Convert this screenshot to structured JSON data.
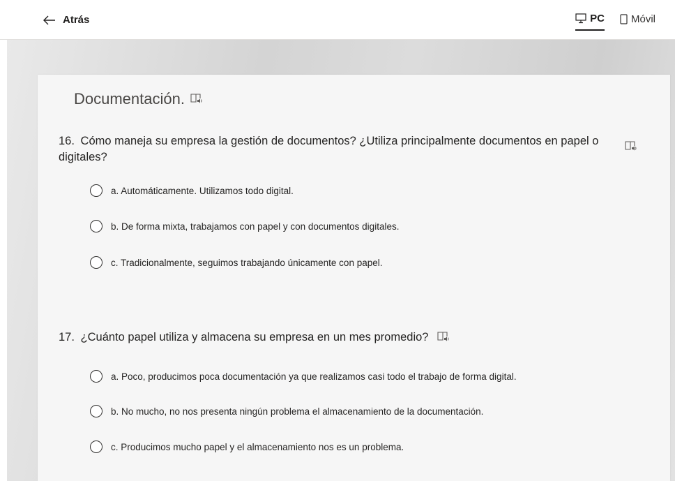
{
  "header": {
    "back_label": "Atrás",
    "views": [
      {
        "label": "PC",
        "active": true
      },
      {
        "label": "Móvil",
        "active": false
      }
    ]
  },
  "section": {
    "title": "Documentación."
  },
  "questions": [
    {
      "number": "16.",
      "text": "Cómo maneja su empresa la gestión de documentos? ¿Utiliza principalmente documentos en papel o digitales?",
      "options": [
        {
          "label": "a. Automáticamente. Utilizamos todo digital."
        },
        {
          "label": "b. De forma mixta, trabajamos con papel y con documentos digitales."
        },
        {
          "label": "c. Tradicionalmente, seguimos trabajando únicamente con papel."
        }
      ]
    },
    {
      "number": "17.",
      "text": "¿Cuánto papel utiliza y almacena su empresa en un mes promedio?",
      "options": [
        {
          "label": "a. Poco, producimos poca documentación ya que realizamos casi todo el trabajo de forma digital."
        },
        {
          "label": "b. No mucho, no nos presenta ningún problema el almacenamiento de la documentación."
        },
        {
          "label": "c. Producimos mucho papel y el almacenamiento nos es un problema."
        }
      ]
    }
  ],
  "icons": {
    "back": "arrow-left-icon",
    "pc": "monitor-icon",
    "mobile": "phone-icon",
    "reader": "immersive-reader-icon"
  },
  "colors": {
    "text": "#252423",
    "card": "#f6f6f6",
    "backdrop": "#d9d9d9"
  }
}
